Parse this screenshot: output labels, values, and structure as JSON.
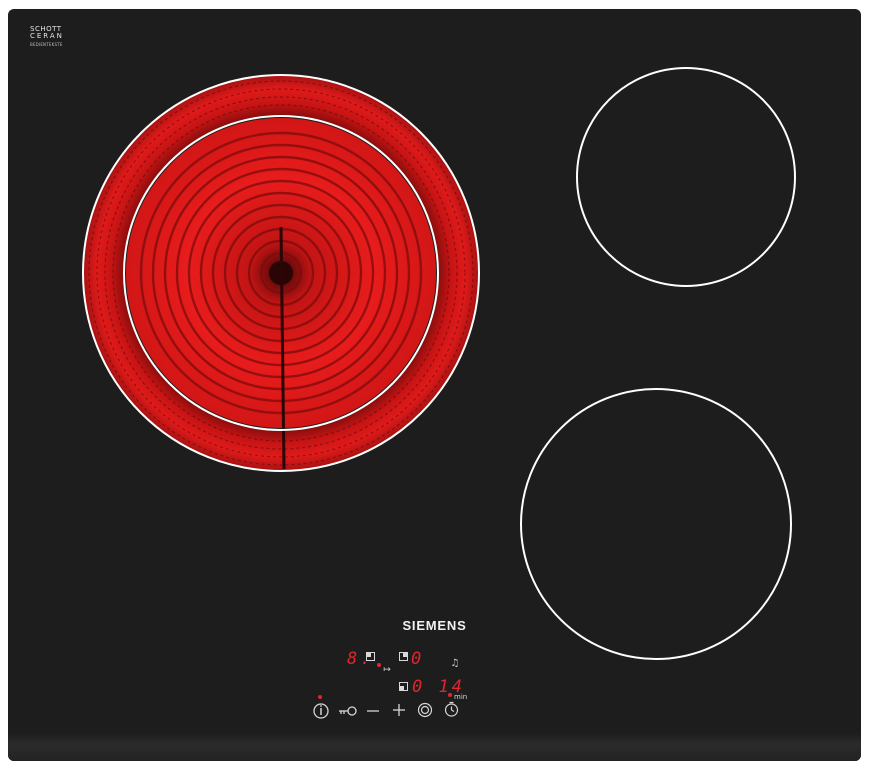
{
  "glass_brand": {
    "line1": "SCHOTT",
    "line2": "CERAN",
    "line3": "BEDIENTEKSTE"
  },
  "brand": "SIEMENS",
  "displays": {
    "zone_level": "8.",
    "rear_level": "0",
    "timer_digits": "0 14",
    "timer_unit": "min"
  },
  "controls": {
    "power_icon": "power-info-icon",
    "lock_icon": "key-lock-icon",
    "minus_icon": "minus-icon",
    "plus_icon": "plus-icon",
    "zone_select_icon": "zone-select-icon",
    "timer_icon": "clock-icon",
    "alarm_icon": "bell-icon",
    "end_icon": "arrow-to-line-icon"
  },
  "colors": {
    "glass": "#1d1d1d",
    "heating_red": "#e41b1b",
    "zone_outline": "#ffffff",
    "display_red": "#e0262c"
  },
  "zones": {
    "front_left": {
      "state": "active"
    },
    "rear_right": {
      "state": "off"
    },
    "front_right": {
      "state": "off"
    }
  }
}
